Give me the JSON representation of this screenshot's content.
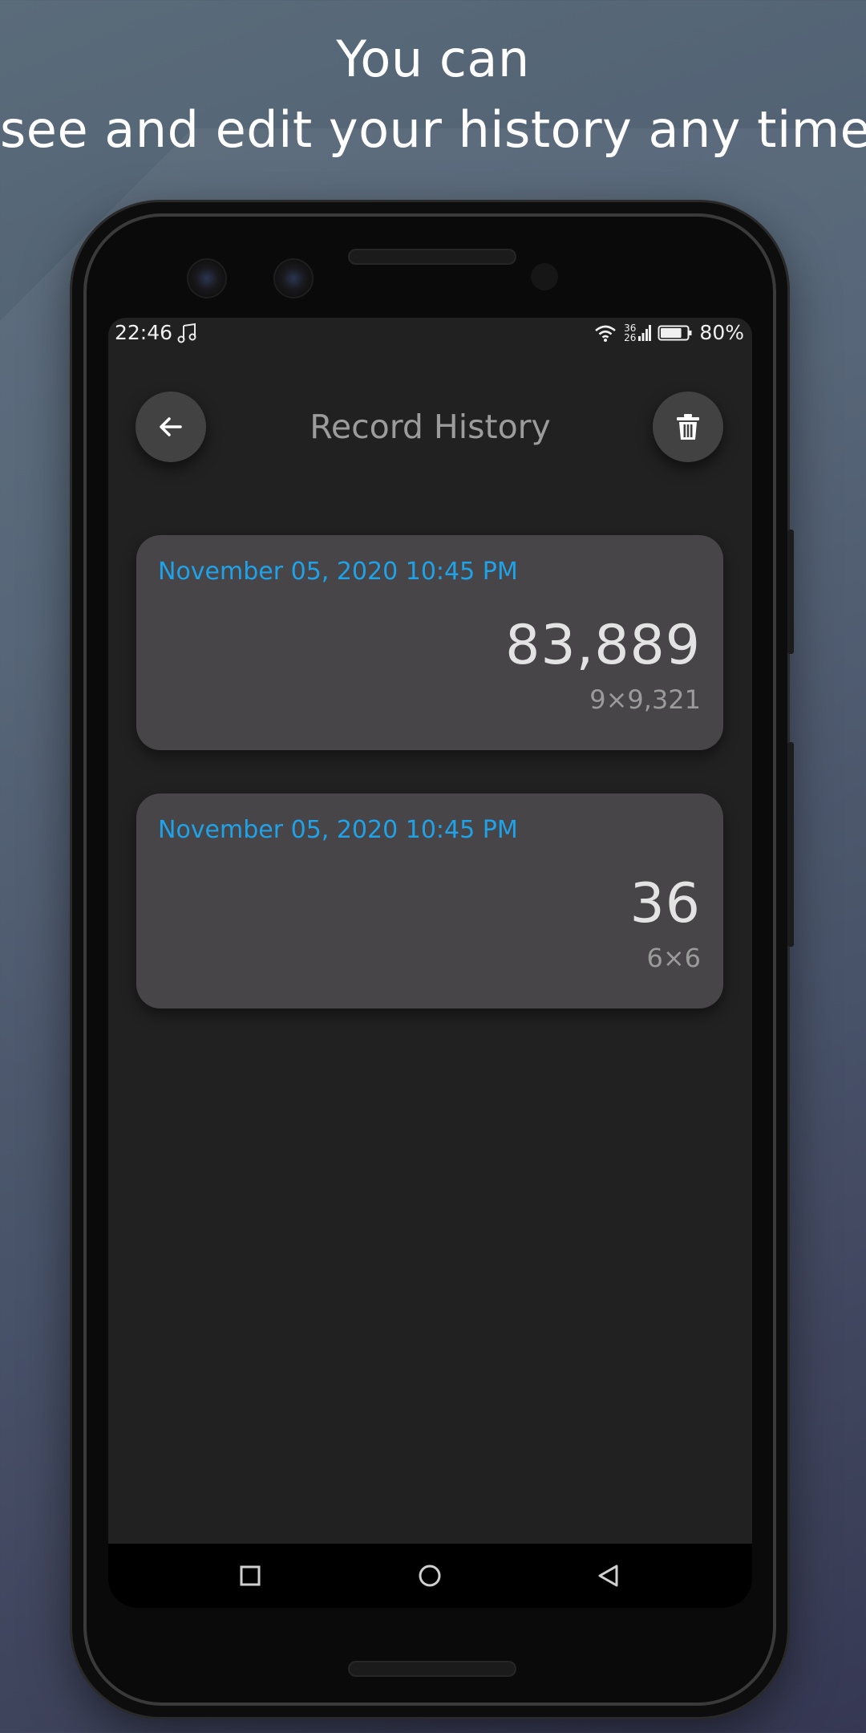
{
  "headline": {
    "line1": "You can",
    "line2": "see and edit your history any time"
  },
  "status_bar": {
    "time": "22:46",
    "network_top": "36",
    "network_bottom": "26",
    "battery_percent": "80%",
    "battery_level": 0.8
  },
  "app": {
    "title": "Record History",
    "back_icon": "arrow-left-icon",
    "delete_icon": "trash-icon"
  },
  "records": [
    {
      "date": "November 05, 2020 10:45 PM",
      "result": "83,889",
      "expression": "9×9,321"
    },
    {
      "date": "November 05, 2020 10:45 PM",
      "result": "36",
      "expression": "6×6"
    }
  ],
  "colors": {
    "accent": "#1fa2e8",
    "card": "#474547",
    "screen": "#212121"
  }
}
